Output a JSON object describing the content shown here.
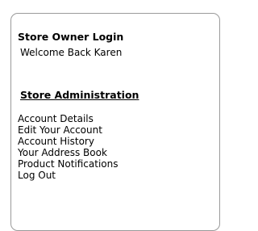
{
  "login_box": {
    "title": "Store Owner Login",
    "welcome": "Welcome Back Karen"
  },
  "admin": {
    "title": "Store Administration",
    "links": [
      "Account Details",
      "Edit Your Account",
      "Account History",
      "Your Address Book",
      "Product Notifications",
      "Log Out"
    ]
  }
}
